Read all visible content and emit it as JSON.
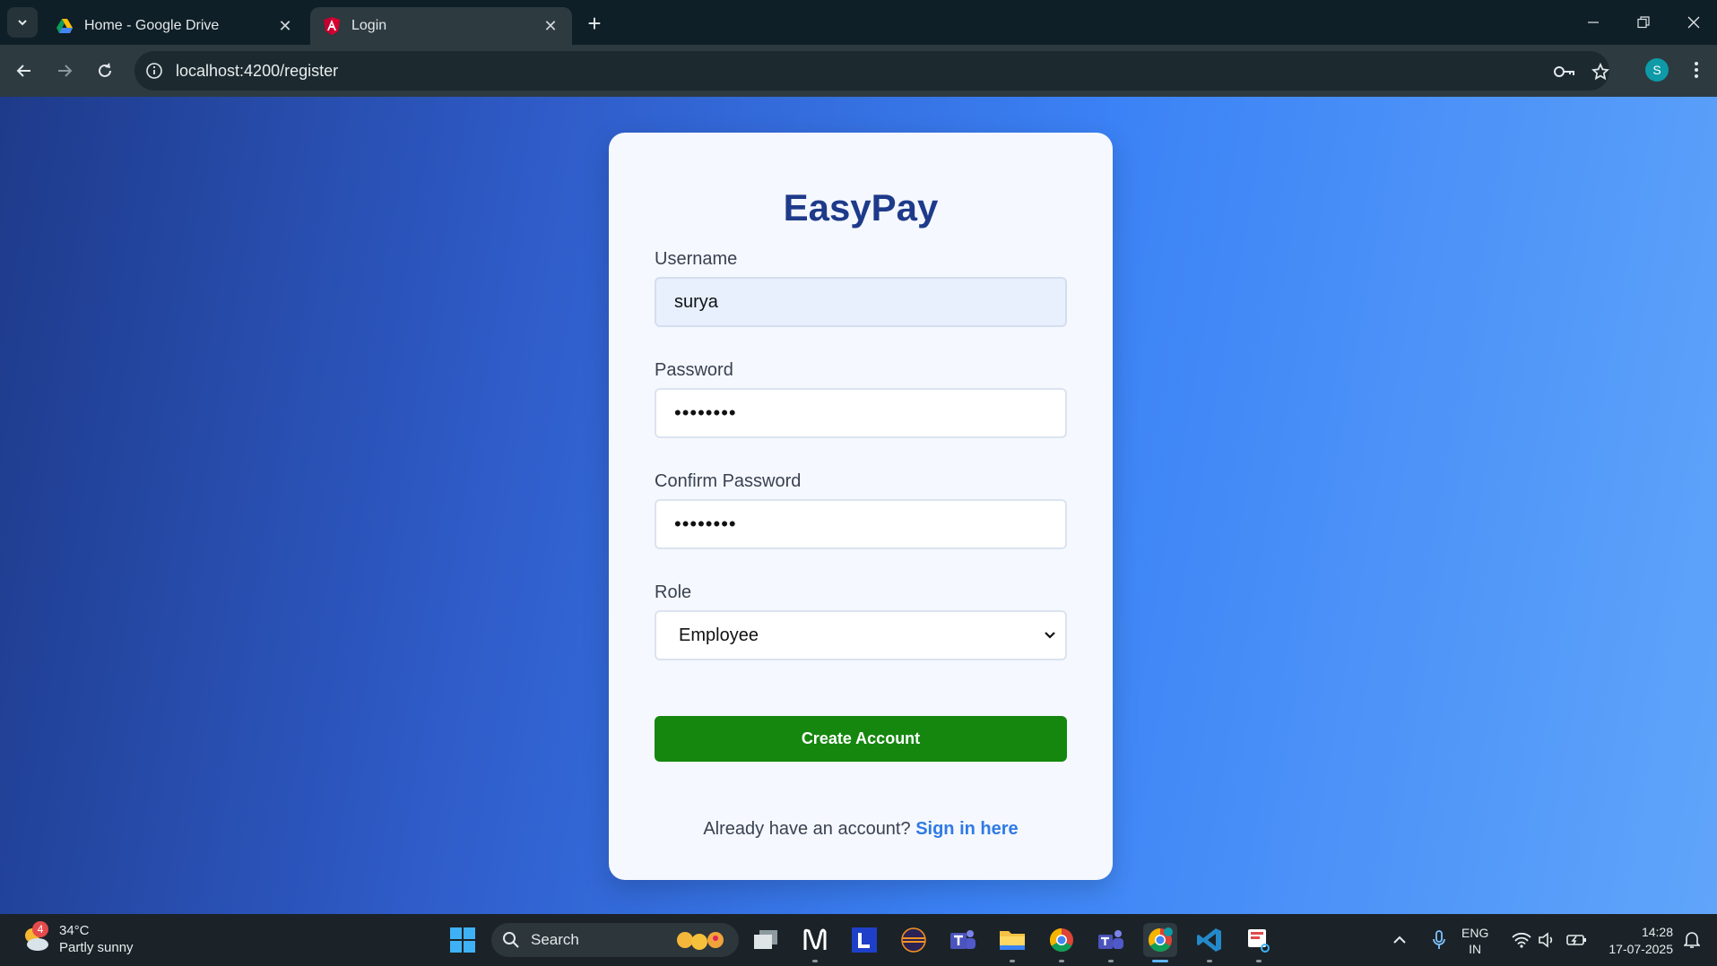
{
  "browser": {
    "tabs": [
      {
        "title": "Home - Google Drive",
        "active": false
      },
      {
        "title": "Login",
        "active": true
      }
    ],
    "url": "localhost:4200/register",
    "profile_initial": "S"
  },
  "page": {
    "brand": "EasyPay",
    "username": {
      "label": "Username",
      "value": "surya"
    },
    "password": {
      "label": "Password",
      "value": "••••••••"
    },
    "confirm_password": {
      "label": "Confirm Password",
      "value": "••••••••"
    },
    "role": {
      "label": "Role",
      "selected": "Employee"
    },
    "create_button": "Create Account",
    "signin_prompt": "Already have an account?",
    "signin_link": "Sign in here",
    "colors": {
      "brand": "#1e3a8a",
      "button": "#15870f",
      "link": "#2f7ae5"
    }
  },
  "taskbar": {
    "weather": {
      "temp": "34°C",
      "condition": "Partly sunny",
      "badge": "4"
    },
    "search_label": "Search",
    "language": {
      "line1": "ENG",
      "line2": "IN"
    },
    "clock": {
      "time": "14:28",
      "date": "17-07-2025"
    },
    "apps": [
      "windows-start-icon",
      "task-view-icon",
      "notion-icon",
      "l-app-icon",
      "eclipse-icon",
      "teams-icon",
      "file-explorer-icon",
      "chrome-icon",
      "teams-alt-icon",
      "chrome-profile-icon",
      "vscode-icon",
      "snipping-tool-icon"
    ]
  }
}
